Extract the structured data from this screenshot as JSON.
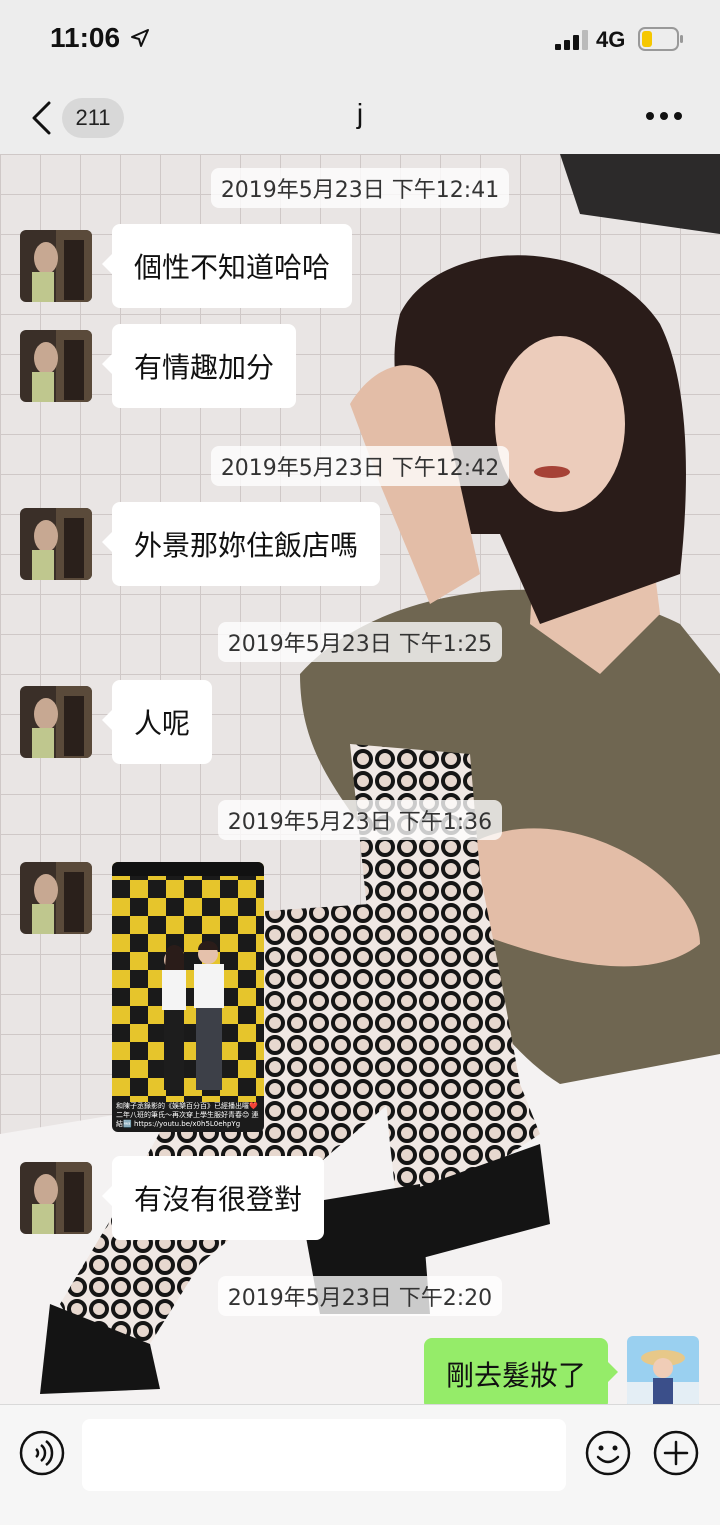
{
  "status_bar": {
    "time": "11:06",
    "network": "4G",
    "icons": [
      "location-arrow-icon",
      "signal-icon",
      "battery-icon"
    ]
  },
  "nav": {
    "unread_count": "211",
    "title": "j",
    "icons": [
      "back-chevron-icon",
      "more-dots-icon"
    ]
  },
  "colors": {
    "incoming_bubble": "#ffffff",
    "outgoing_bubble": "#95ec69",
    "background": "#ededed"
  },
  "messages": [
    {
      "timestamp": "2019年5月23日 下午12:41"
    },
    {
      "text": "個性不知道哈哈"
    },
    {
      "text": "有情趣加分"
    },
    {
      "timestamp": "2019年5月23日 下午12:42"
    },
    {
      "text": "外景那妳住飯店嗎"
    },
    {
      "timestamp": "2019年5月23日 下午1:25"
    },
    {
      "text": "人呢"
    },
    {
      "timestamp": "2019年5月23日 下午1:36"
    },
    {
      "image_caption": "和陳子丞錄影的《娛樂百分百》已經播出囉❤️ 二年八班的筆氏～再次穿上學生服好青春😊 連結🆓 https://youtu.be/x0h5L0ehpYg"
    },
    {
      "text": "有沒有很登對"
    },
    {
      "timestamp": "2019年5月23日 下午2:20"
    },
    {
      "text": "剛去髮妝了"
    }
  ],
  "input_bar": {
    "icons": [
      "voice-icon",
      "emoji-icon",
      "plus-icon"
    ]
  }
}
